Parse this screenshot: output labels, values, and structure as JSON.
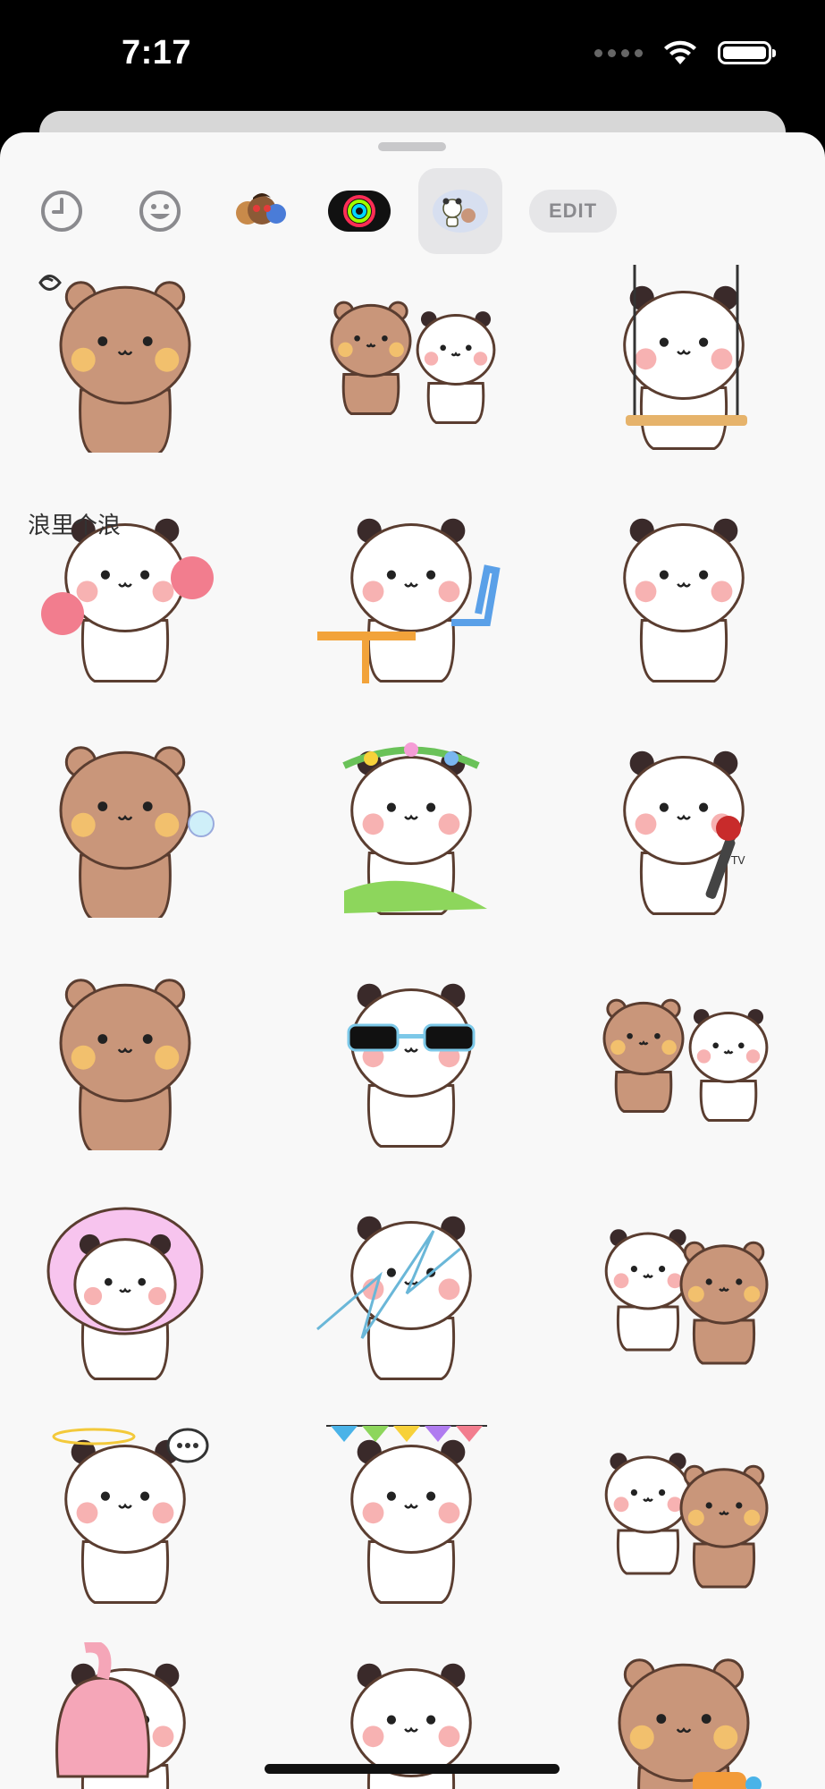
{
  "status": {
    "time": "7:17"
  },
  "app_strip": {
    "items": [
      {
        "name": "recents-icon"
      },
      {
        "name": "emoji-icon"
      },
      {
        "name": "memoji-icon"
      },
      {
        "name": "activity-rings-icon"
      },
      {
        "name": "panda-sticker-pack-icon",
        "selected": true
      }
    ],
    "edit_label": "EDIT"
  },
  "stickers": [
    {
      "kind": "bear",
      "extra": "scribble"
    },
    {
      "kind": "bear-panda"
    },
    {
      "kind": "panda",
      "extra": "swing"
    },
    {
      "kind": "panda",
      "extra": "cotton-candy",
      "text": "浪里个浪"
    },
    {
      "kind": "panda",
      "extra": "table"
    },
    {
      "kind": "panda",
      "extra": "back"
    },
    {
      "kind": "bear",
      "extra": "bubble"
    },
    {
      "kind": "panda",
      "extra": "flower-crown"
    },
    {
      "kind": "panda",
      "extra": "microphone",
      "mic_text": "TV"
    },
    {
      "kind": "bear",
      "extra": "surprised"
    },
    {
      "kind": "panda",
      "extra": "sunglasses"
    },
    {
      "kind": "bear-panda",
      "extra": "costumes"
    },
    {
      "kind": "panda",
      "extra": "pink-hair"
    },
    {
      "kind": "panda",
      "extra": "lightning"
    },
    {
      "kind": "panda-bear",
      "extra": "hug"
    },
    {
      "kind": "panda",
      "extra": "halo"
    },
    {
      "kind": "panda",
      "extra": "bunting"
    },
    {
      "kind": "panda-bear",
      "extra": "kiss"
    },
    {
      "kind": "panda",
      "extra": "flamingo"
    },
    {
      "kind": "panda"
    },
    {
      "kind": "bear",
      "extra": "toy-gun"
    }
  ],
  "colors": {
    "bear": "#c9967a",
    "bear_dark": "#9c6e58",
    "panda_ear": "#3a2a2a",
    "cheek": "#f7b2b2",
    "bear_cheek": "#f2c06d",
    "sheet_bg": "#f8f8f8"
  }
}
